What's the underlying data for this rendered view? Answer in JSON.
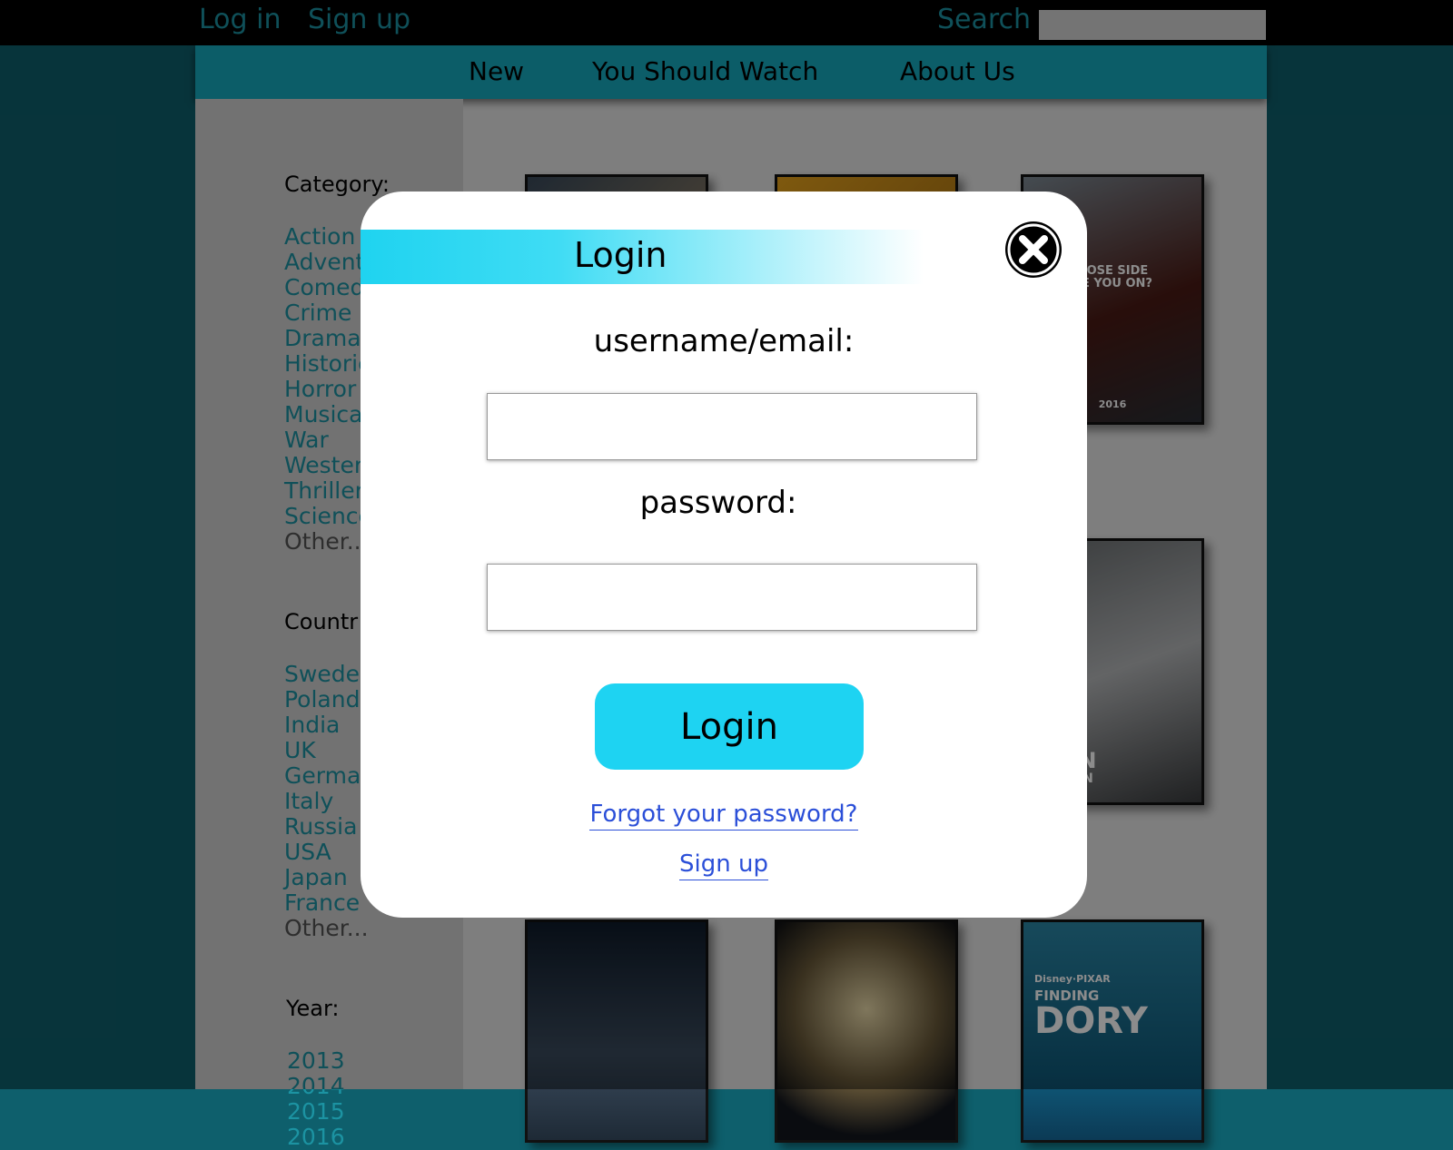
{
  "topbar": {
    "login_label": "Log in",
    "signup_label": "Sign up",
    "search_label": "Search",
    "search_value": ""
  },
  "nav": {
    "items": [
      {
        "label": "New"
      },
      {
        "label": "You Should Watch"
      },
      {
        "label": "About Us"
      }
    ]
  },
  "sidebar": {
    "category_heading": "Category:",
    "categories": [
      "Action",
      "Advent",
      "Comed",
      "Crime",
      "Drama",
      "Historic",
      "Horror",
      "Musica",
      "War",
      "Wester",
      "Thriller",
      "Science",
      "Other..."
    ],
    "country_heading": "Countr",
    "countries": [
      "Sweden",
      "Poland",
      "India",
      "UK",
      "German",
      "Italy",
      "Russia",
      "USA",
      "Japan",
      "France",
      "Other..."
    ],
    "year_heading": "Year:",
    "years": [
      "2013",
      "2014",
      "2015",
      "2016"
    ]
  },
  "posters": {
    "p3_caption_1": "HOSE SIDE",
    "p3_caption_2": "RE YOU ON?",
    "p3_year": "2016",
    "p4_caption_1": "NDON",
    "p4_caption_2": "S FALLEN",
    "p7_brand": "Disney·PIXAR",
    "p7_caption_1": "FINDING",
    "p7_caption_2": "DORY"
  },
  "modal": {
    "title": "Login",
    "username_label": "username/email:",
    "username_value": "",
    "password_label": "password:",
    "password_value": "",
    "login_button_label": "Login",
    "forgot_link": "Forgot  your password?",
    "signup_link": "Sign up"
  },
  "colors": {
    "page_bg": "#0e5f6c",
    "accent": "#1ed3f2",
    "link_teal": "#1c93a2",
    "link_blue": "#2b4fd8"
  }
}
